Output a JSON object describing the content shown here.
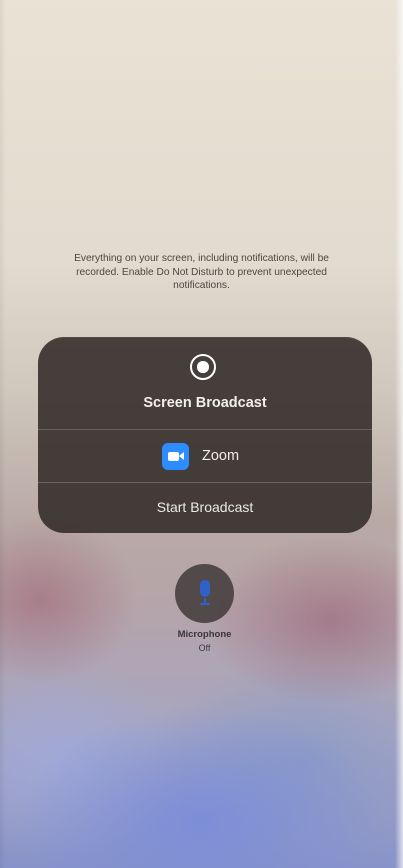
{
  "info": {
    "message": "Everything on your screen, including notifications, will be recorded. Enable Do Not Disturb to prevent unexpected notifications."
  },
  "broadcast": {
    "title": "Screen Broadcast",
    "icon": "record-icon",
    "app": {
      "name": "Zoom",
      "icon": "zoom-camera-icon",
      "color": "#2d8cff"
    },
    "start_label": "Start Broadcast"
  },
  "microphone": {
    "label": "Microphone",
    "state": "Off",
    "icon": "microphone-icon",
    "icon_color": "#2f62c8"
  }
}
